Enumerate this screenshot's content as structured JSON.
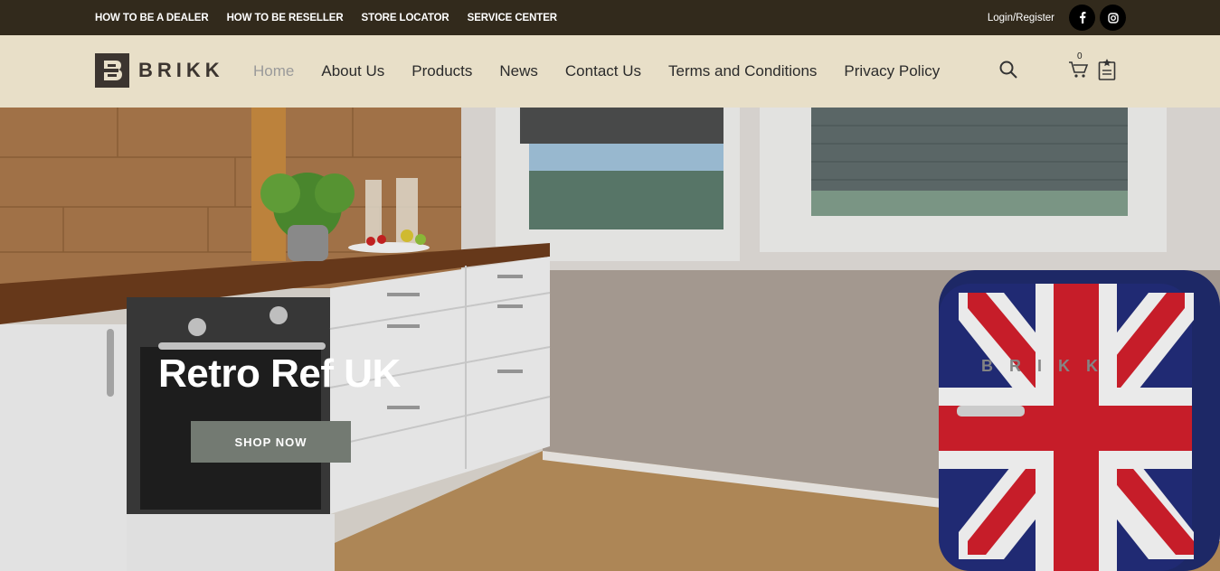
{
  "topbar": {
    "links": [
      "HOW TO BE A DEALER",
      "HOW TO BE RESELLER",
      "STORE LOCATOR",
      "SERVICE CENTER"
    ],
    "login_label": "Login/Register",
    "social": [
      "facebook-icon",
      "instagram-icon"
    ]
  },
  "header": {
    "logo_text": "BRIKK",
    "nav": [
      "Home",
      "About Us",
      "Products",
      "News",
      "Contact Us",
      "Terms and Conditions",
      "Privacy Policy"
    ],
    "active_nav": "Home",
    "cart_count": "0",
    "icons": [
      "search-icon",
      "cart-icon",
      "wishlist-icon"
    ]
  },
  "hero": {
    "title": "Retro Ref UK",
    "button_label": "SHOP NOW",
    "fridge_brand": "BRIKK"
  },
  "colors": {
    "topbar_bg": "#322a1c",
    "header_bg": "#e8dfc8",
    "button_bg": "#737a72"
  }
}
